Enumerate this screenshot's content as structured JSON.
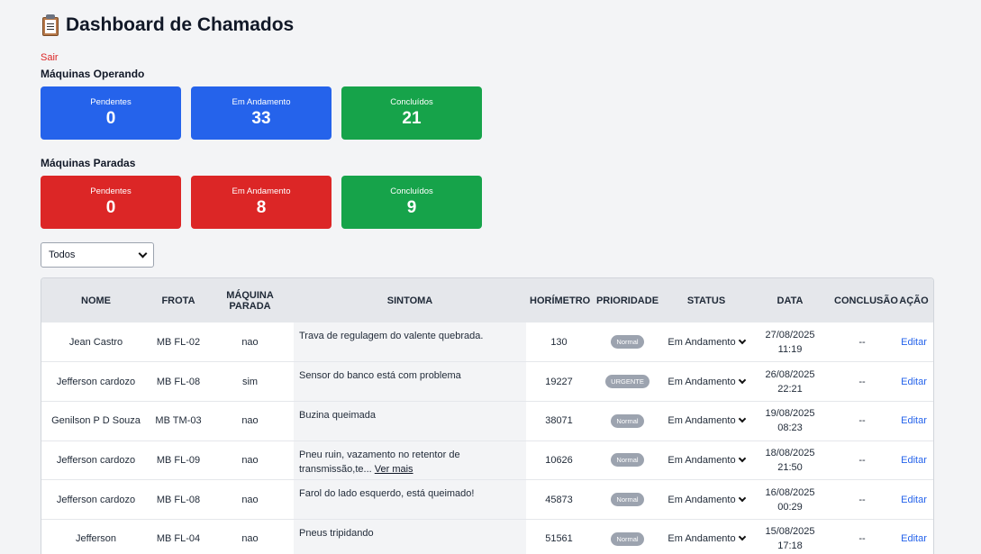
{
  "header": {
    "title": "Dashboard de Chamados",
    "logout": "Sair"
  },
  "operando": {
    "title": "Máquinas Operando",
    "cards": [
      {
        "label": "Pendentes",
        "value": "0",
        "color": "#2563eb"
      },
      {
        "label": "Em Andamento",
        "value": "33",
        "color": "#2563eb"
      },
      {
        "label": "Concluídos",
        "value": "21",
        "color": "#16a34a"
      }
    ]
  },
  "paradas": {
    "title": "Máquinas Paradas",
    "cards": [
      {
        "label": "Pendentes",
        "value": "0",
        "color": "#dc2626"
      },
      {
        "label": "Em Andamento",
        "value": "8",
        "color": "#dc2626"
      },
      {
        "label": "Concluídos",
        "value": "9",
        "color": "#16a34a"
      }
    ]
  },
  "filter": {
    "selected": "Todos"
  },
  "table": {
    "headers": [
      "NOME",
      "FROTA",
      "MÁQUINA PARADA",
      "SINTOMA",
      "HORÍMETRO",
      "PRIORIDADE",
      "STATUS",
      "DATA",
      "CONCLUSÃO",
      "AÇÃO"
    ],
    "rows": [
      {
        "nome": "Jean Castro",
        "frota": "MB FL-02",
        "parada": "nao",
        "sintoma": "Trava de regulagem do valente quebrada.",
        "more": "",
        "horimetro": "130",
        "prioridade": "Normal",
        "status": "Em Andamento",
        "data": "27/08/2025",
        "hora": "11:19",
        "conclusao": "--",
        "acao": "Editar"
      },
      {
        "nome": "Jefferson cardozo",
        "frota": "MB FL-08",
        "parada": "sim",
        "sintoma": "Sensor do banco está com problema",
        "more": "",
        "horimetro": "19227",
        "prioridade": "URGENTE",
        "status": "Em Andamento",
        "data": "26/08/2025",
        "hora": "22:21",
        "conclusao": "--",
        "acao": "Editar"
      },
      {
        "nome": "Genilson P D Souza",
        "frota": "MB TM-03",
        "parada": "nao",
        "sintoma": "Buzina queimada",
        "more": "",
        "horimetro": "38071",
        "prioridade": "Normal",
        "status": "Em Andamento",
        "data": "19/08/2025",
        "hora": "08:23",
        "conclusao": "--",
        "acao": "Editar"
      },
      {
        "nome": "Jefferson cardozo",
        "frota": "MB FL-09",
        "parada": "nao",
        "sintoma": "Pneu ruin, vazamento no retentor de transmissão,te...",
        "more": "Ver mais",
        "horimetro": "10626",
        "prioridade": "Normal",
        "status": "Em Andamento",
        "data": "18/08/2025",
        "hora": "21:50",
        "conclusao": "--",
        "acao": "Editar"
      },
      {
        "nome": "Jefferson cardozo",
        "frota": "MB FL-08",
        "parada": "nao",
        "sintoma": "Farol do lado esquerdo, está queimado!",
        "more": "",
        "horimetro": "45873",
        "prioridade": "Normal",
        "status": "Em Andamento",
        "data": "16/08/2025",
        "hora": "00:29",
        "conclusao": "--",
        "acao": "Editar"
      },
      {
        "nome": "Jefferson",
        "frota": "MB FL-04",
        "parada": "nao",
        "sintoma": "Pneus tripidando",
        "more": "",
        "horimetro": "51561",
        "prioridade": "Normal",
        "status": "Em Andamento",
        "data": "15/08/2025",
        "hora": "17:18",
        "conclusao": "--",
        "acao": "Editar"
      }
    ]
  }
}
